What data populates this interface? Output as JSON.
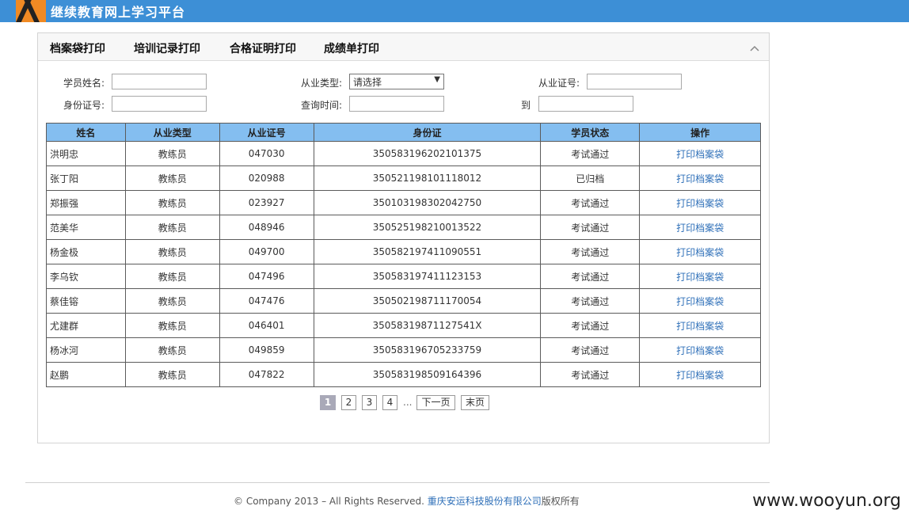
{
  "header": {
    "site_title": "继续教育网上学习平台"
  },
  "tabs": [
    {
      "label": "档案袋打印"
    },
    {
      "label": "培训记录打印"
    },
    {
      "label": "合格证明打印"
    },
    {
      "label": "成绩单打印"
    }
  ],
  "form": {
    "name_label": "学员姓名:",
    "name_value": "",
    "type_label": "从业类型:",
    "type_selected": "请选择",
    "cert_label": "从业证号:",
    "cert_value": "",
    "id_label": "身份证号:",
    "id_value": "",
    "time_label": "查询时间:",
    "time_from": "",
    "to_label": "到",
    "time_to": ""
  },
  "table": {
    "headers": [
      "姓名",
      "从业类型",
      "从业证号",
      "身份证",
      "学员状态",
      "操作"
    ],
    "rows": [
      {
        "name": "洪明忠",
        "type": "教练员",
        "cert": "047030",
        "id": "350583196202101375",
        "status": "考试通过",
        "action": "打印档案袋"
      },
      {
        "name": "张丁阳",
        "type": "教练员",
        "cert": "020988",
        "id": "350521198101118012",
        "status": "已归档",
        "action": "打印档案袋"
      },
      {
        "name": "郑振强",
        "type": "教练员",
        "cert": "023927",
        "id": "350103198302042750",
        "status": "考试通过",
        "action": "打印档案袋"
      },
      {
        "name": "范美华",
        "type": "教练员",
        "cert": "048946",
        "id": "350525198210013522",
        "status": "考试通过",
        "action": "打印档案袋"
      },
      {
        "name": "杨金极",
        "type": "教练员",
        "cert": "049700",
        "id": "350582197411090551",
        "status": "考试通过",
        "action": "打印档案袋"
      },
      {
        "name": "李乌钦",
        "type": "教练员",
        "cert": "047496",
        "id": "350583197411123153",
        "status": "考试通过",
        "action": "打印档案袋"
      },
      {
        "name": "蔡佳镕",
        "type": "教练员",
        "cert": "047476",
        "id": "350502198711170054",
        "status": "考试通过",
        "action": "打印档案袋"
      },
      {
        "name": "尤建群",
        "type": "教练员",
        "cert": "046401",
        "id": "35058319871127541X",
        "status": "考试通过",
        "action": "打印档案袋"
      },
      {
        "name": "杨冰河",
        "type": "教练员",
        "cert": "049859",
        "id": "350583196705233759",
        "status": "考试通过",
        "action": "打印档案袋"
      },
      {
        "name": "赵鹏",
        "type": "教练员",
        "cert": "047822",
        "id": "350583198509164396",
        "status": "考试通过",
        "action": "打印档案袋"
      }
    ]
  },
  "pager": {
    "pages": [
      "1",
      "2",
      "3",
      "4"
    ],
    "current": "1",
    "ellipsis": "...",
    "next": "下一页",
    "last": "末页"
  },
  "footer": {
    "copyright": "© Company 2013 – All Rights Reserved.",
    "company": "重庆安运科技股份有限公司",
    "suffix": "版权所有"
  },
  "watermark": "www.wooyun.org",
  "colors": {
    "topbar": "#3d8fd6",
    "table_header": "#84bef0",
    "link": "#2e6fb8"
  }
}
